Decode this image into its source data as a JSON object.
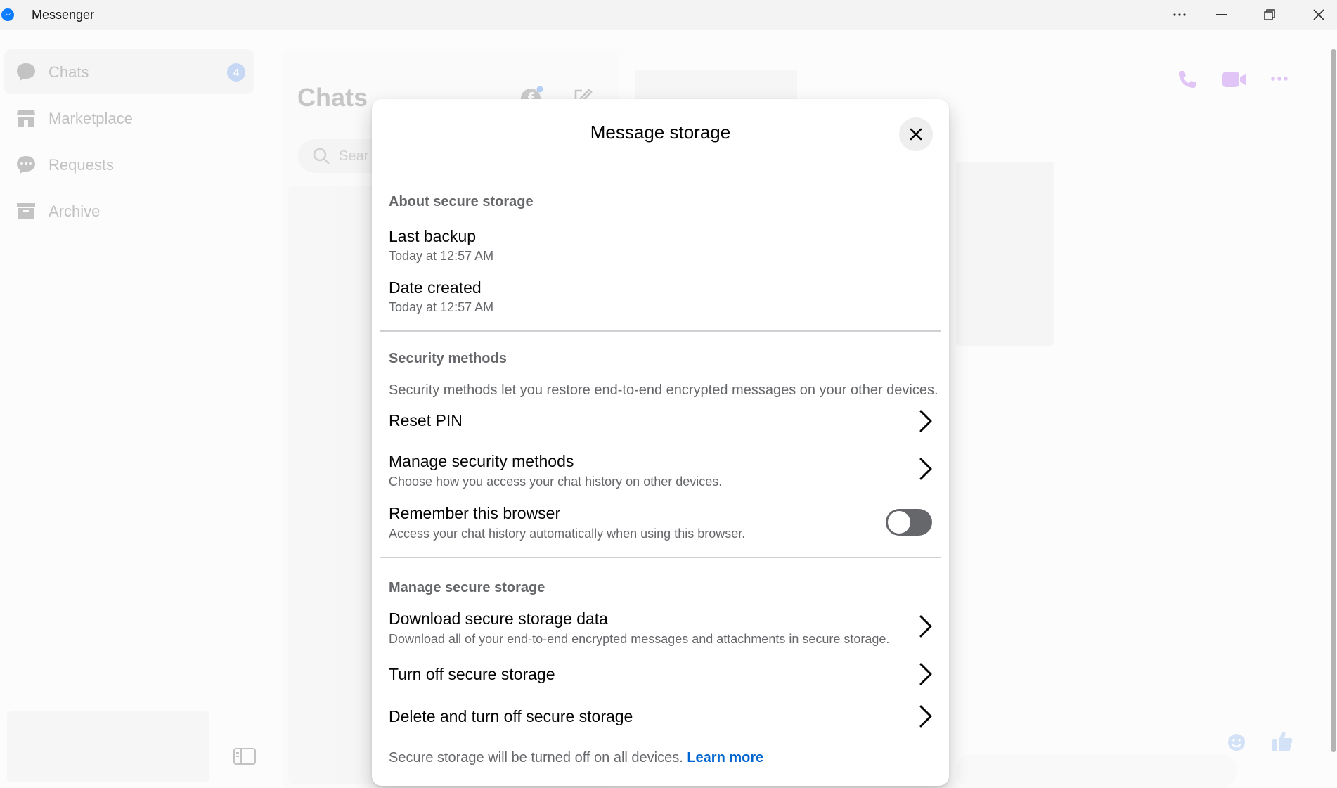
{
  "window": {
    "title": "Messenger",
    "controls": [
      "more-icon",
      "minimize-icon",
      "restore-icon",
      "close-icon"
    ]
  },
  "sidebar": {
    "items": [
      {
        "label": "Chats",
        "icon": "chat-bubble-icon",
        "badge": "4",
        "active": true
      },
      {
        "label": "Marketplace",
        "icon": "storefront-icon"
      },
      {
        "label": "Requests",
        "icon": "message-requests-icon"
      },
      {
        "label": "Archive",
        "icon": "archive-box-icon"
      }
    ]
  },
  "chat_list": {
    "title": "Chats",
    "search_placeholder": "Sear"
  },
  "modal": {
    "title": "Message storage",
    "about": {
      "heading": "About secure storage",
      "last_backup_label": "Last backup",
      "last_backup_value": "Today at 12:57 AM",
      "date_created_label": "Date created",
      "date_created_value": "Today at 12:57 AM"
    },
    "security": {
      "heading": "Security methods",
      "description": "Security methods let you restore end-to-end encrypted messages on your other devices.",
      "reset_pin": "Reset PIN",
      "manage_title": "Manage security methods",
      "manage_sub": "Choose how you access your chat history on other devices.",
      "remember_title": "Remember this browser",
      "remember_sub": "Access your chat history automatically when using this browser.",
      "remember_enabled": false
    },
    "manage": {
      "heading": "Manage secure storage",
      "download_title": "Download secure storage data",
      "download_sub": "Download all of your end-to-end encrypted messages and attachments in secure storage.",
      "turn_off": "Turn off secure storage",
      "delete": "Delete and turn off secure storage"
    },
    "footer": {
      "text": "Secure storage will be turned off on all devices.",
      "link": "Learn more"
    }
  },
  "colors": {
    "accent": "#0a7cff",
    "link": "#0064d1",
    "secondary_text": "#65676b",
    "toggle_off": "#65676b",
    "header_icons": "#c89af0"
  }
}
